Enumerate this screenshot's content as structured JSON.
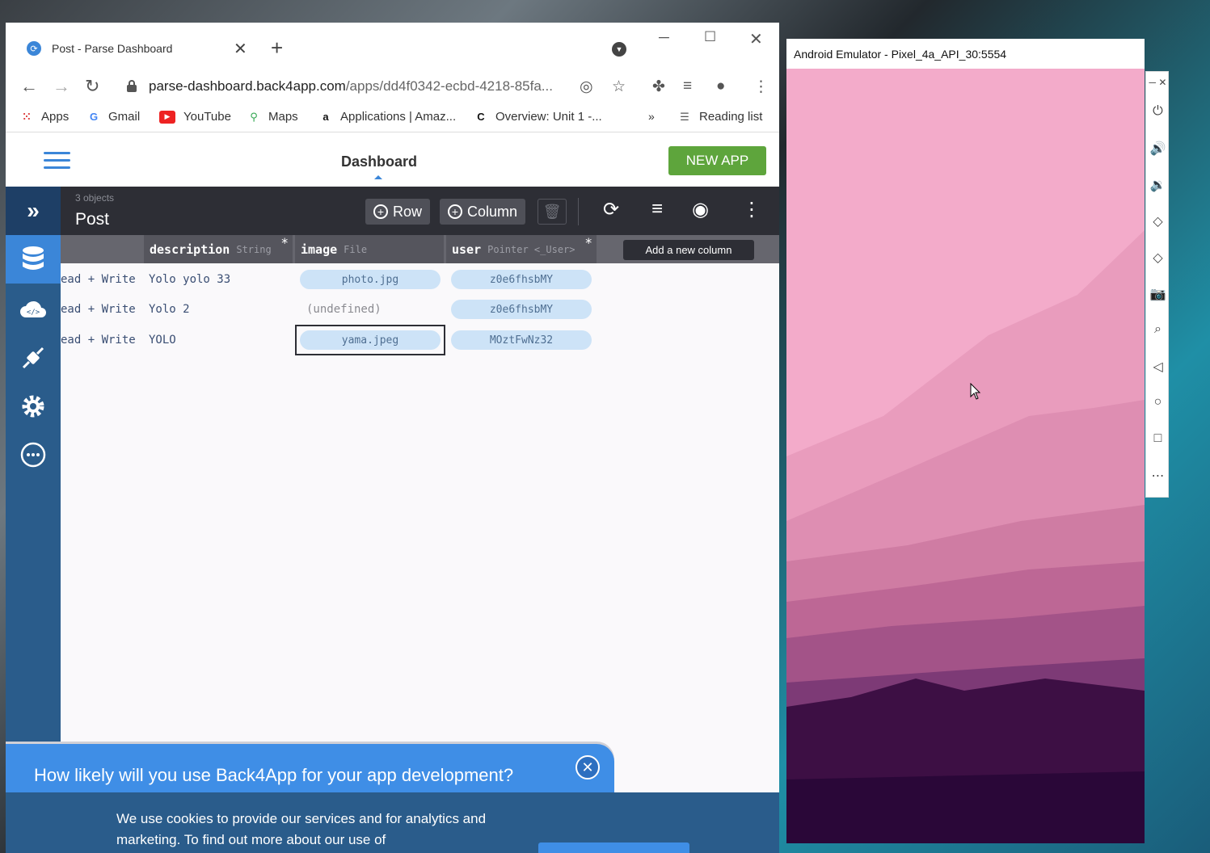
{
  "browser": {
    "tab_title": "Post - Parse Dashboard",
    "url_host": "parse-dashboard.back4app.com",
    "url_path": "/apps/dd4f0342-ecbd-4218-85fa...",
    "bookmarks": [
      "Apps",
      "Gmail",
      "YouTube",
      "Maps",
      "Applications | Amaz...",
      "Overview: Unit 1 -...",
      "Reading list"
    ],
    "bookmarks_more": "»"
  },
  "app": {
    "header_title": "Dashboard",
    "new_app_label": "NEW APP",
    "object_count": "3 objects",
    "class_name": "Post",
    "row_button": "Row",
    "column_button": "Column",
    "add_column_button": "Add a new column",
    "columns": [
      {
        "name": "description",
        "type": "String",
        "required": "*"
      },
      {
        "name": "image",
        "type": "File",
        "required": ""
      },
      {
        "name": "user",
        "type": "Pointer <_User>",
        "required": "*"
      }
    ],
    "rows": [
      {
        "acl": "ead + Write",
        "description": "Yolo yolo 33",
        "image": "photo.jpg",
        "user": "z0e6fhsbMY"
      },
      {
        "acl": "ead + Write",
        "description": "Yolo 2",
        "image": "(undefined)",
        "user": "z0e6fhsbMY"
      },
      {
        "acl": "ead + Write",
        "description": "YOLO",
        "image": "yama.jpeg",
        "user": "MOztFwNz32"
      }
    ]
  },
  "survey": {
    "question": "How likely will you use Back4App for your app development?"
  },
  "cookie": {
    "text": "We use cookies to provide our services and for analytics and marketing. To find out more about our use of"
  },
  "emulator": {
    "title": "Android Emulator - Pixel_4a_API_30:5554"
  },
  "colors": {
    "sidebar": "#2a5c8b",
    "sidebar_active": "#3b86d8",
    "toolbar": "#2d2e35",
    "new_app": "#5ea53c",
    "pill": "#cde3f7"
  }
}
